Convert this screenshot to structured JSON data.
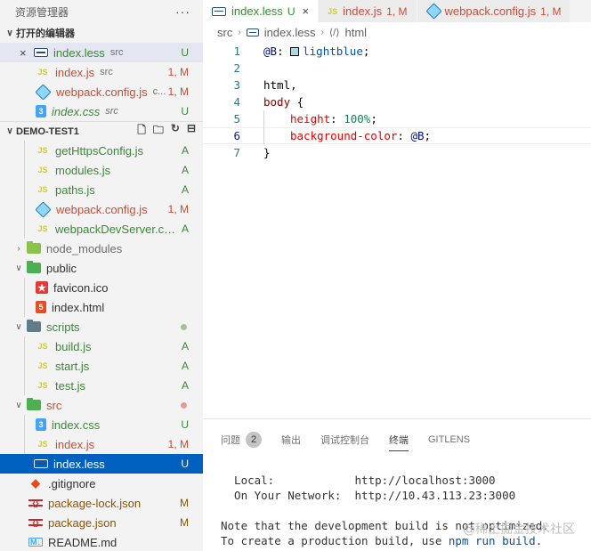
{
  "explorer": {
    "title": "资源管理器",
    "more": "···",
    "open_editors_title": "打开的编辑器",
    "project_title": "DEMO-TEST1"
  },
  "open_editors": [
    {
      "name": "index.less",
      "desc": "src",
      "status": "U",
      "icon": "less-icon"
    },
    {
      "name": "index.js",
      "desc": "src",
      "status": "1, M",
      "icon": "js-icon"
    },
    {
      "name": "webpack.config.js",
      "desc": "c...",
      "status": "1, M",
      "icon": "webpack-icon"
    },
    {
      "name": "index.css",
      "desc": "src",
      "status": "U",
      "icon": "css-icon"
    }
  ],
  "tree": [
    {
      "name": "getHttpsConfig.js",
      "status": "A",
      "icon": "JS"
    },
    {
      "name": "modules.js",
      "status": "A",
      "icon": "JS"
    },
    {
      "name": "paths.js",
      "status": "A",
      "icon": "JS"
    },
    {
      "name": "webpack.config.js",
      "status": "1, M",
      "icon": "webpack"
    },
    {
      "name": "webpackDevServer.co...",
      "status": "A",
      "icon": "JS"
    },
    {
      "name": "node_modules"
    },
    {
      "name": "public"
    },
    {
      "name": "favicon.ico"
    },
    {
      "name": "index.html"
    },
    {
      "name": "scripts"
    },
    {
      "name": "build.js",
      "status": "A",
      "icon": "JS"
    },
    {
      "name": "start.js",
      "status": "A",
      "icon": "JS"
    },
    {
      "name": "test.js",
      "status": "A",
      "icon": "JS"
    },
    {
      "name": "src"
    },
    {
      "name": "index.css",
      "status": "U"
    },
    {
      "name": "index.js",
      "status": "1, M",
      "icon": "JS"
    },
    {
      "name": "index.less",
      "status": "U"
    },
    {
      "name": ".gitignore"
    },
    {
      "name": "package-lock.json",
      "status": "M"
    },
    {
      "name": "package.json",
      "status": "M"
    },
    {
      "name": "README.md"
    }
  ],
  "icons": {
    "js": "JS",
    "css": "3",
    "html": "5",
    "star": "★",
    "git": "◆",
    "json": "{}",
    "md": "M↓",
    "close": "×",
    "chev_down": "∨",
    "chev_right": "›"
  },
  "tabs": [
    {
      "name": "index.less",
      "status": "U",
      "close": "×"
    },
    {
      "name": "index.js",
      "status": "1, M"
    },
    {
      "name": "webpack.config.js",
      "status": "1, M"
    }
  ],
  "breadcrumb": {
    "folder": "src",
    "file": "index.less",
    "symbol": "html"
  },
  "code": {
    "line_numbers": [
      "1",
      "2",
      "3",
      "4",
      "5",
      "6",
      "7"
    ],
    "l1_var": "@B",
    "l1_colon": ": ",
    "l1_val": "lightblue",
    "l1_end": ";",
    "l3": "html,",
    "l4_sel": "body",
    "l4_brace": " {",
    "l5_prop": "height",
    "l5_colon": ": ",
    "l5_val": "100%",
    "l5_end": ";",
    "l6_prop": "background-color",
    "l6_colon": ": ",
    "l6_val": "@B",
    "l6_end": ";",
    "l7": "}"
  },
  "panel": {
    "tabs": [
      "问题",
      "输出",
      "调试控制台",
      "终端",
      "GITLENS"
    ],
    "problems_count": "2",
    "terminal": {
      "local_label": "  Local:            ",
      "local_url": "http://localhost:3000",
      "network_label": "  On Your Network:  ",
      "network_url": "http://10.43.113.23:3000",
      "note1": "Note that the development build is not optimized.",
      "note2_pre": "To create a production build, use ",
      "note2_cmd": "npm run build",
      "note2_end": "."
    },
    "watermark": "@稀土掘金技术社区"
  },
  "colors": {
    "selection": "#0060c0",
    "untracked": "#388a34",
    "modified": "#895503",
    "error": "#c74e39"
  }
}
